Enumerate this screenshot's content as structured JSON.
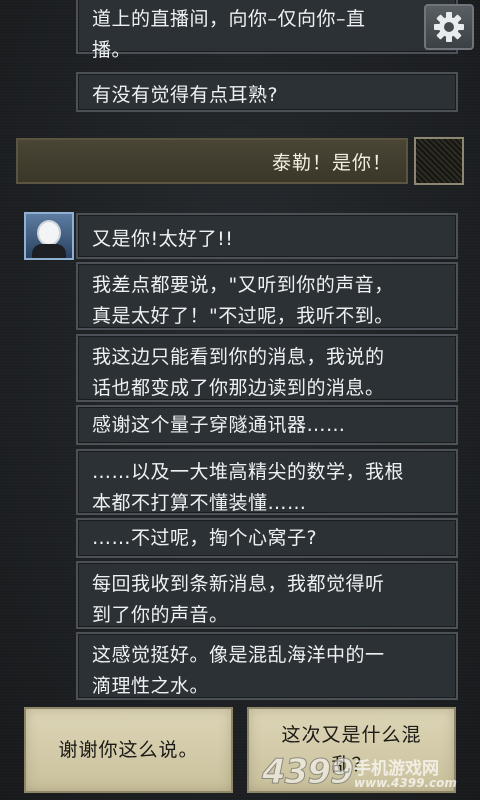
{
  "messages_top": [
    "道上的直播间，向你–仅向你–直\n播。",
    "有没有觉得有点耳熟?"
  ],
  "player_reply": "泰勒！是你！",
  "taylor_messages": [
    "又是你!太好了!!",
    "我差点都要说，\"又听到你的声音，\n真是太好了！\"不过呢，我听不到。",
    "我这边只能看到你的消息，我说的\n话也都变成了你那边读到的消息。",
    "感谢这个量子穿隧通讯器……",
    "……以及一大堆高精尖的数学，我根\n本都不打算不懂装懂……",
    "……不过呢，掏个心窝子?",
    "每回我收到条新消息，我都觉得听\n到了你的声音。",
    "这感觉挺好。像是混乱海洋中的一\n滴理性之水。"
  ],
  "choices": [
    "谢谢你这么说。",
    "这次又是什么混\n乱？"
  ],
  "watermark": {
    "brand": "4399",
    "cn": "手机游戏网",
    "url": "www.4399.com"
  },
  "icons": {
    "settings": "gear-icon"
  }
}
